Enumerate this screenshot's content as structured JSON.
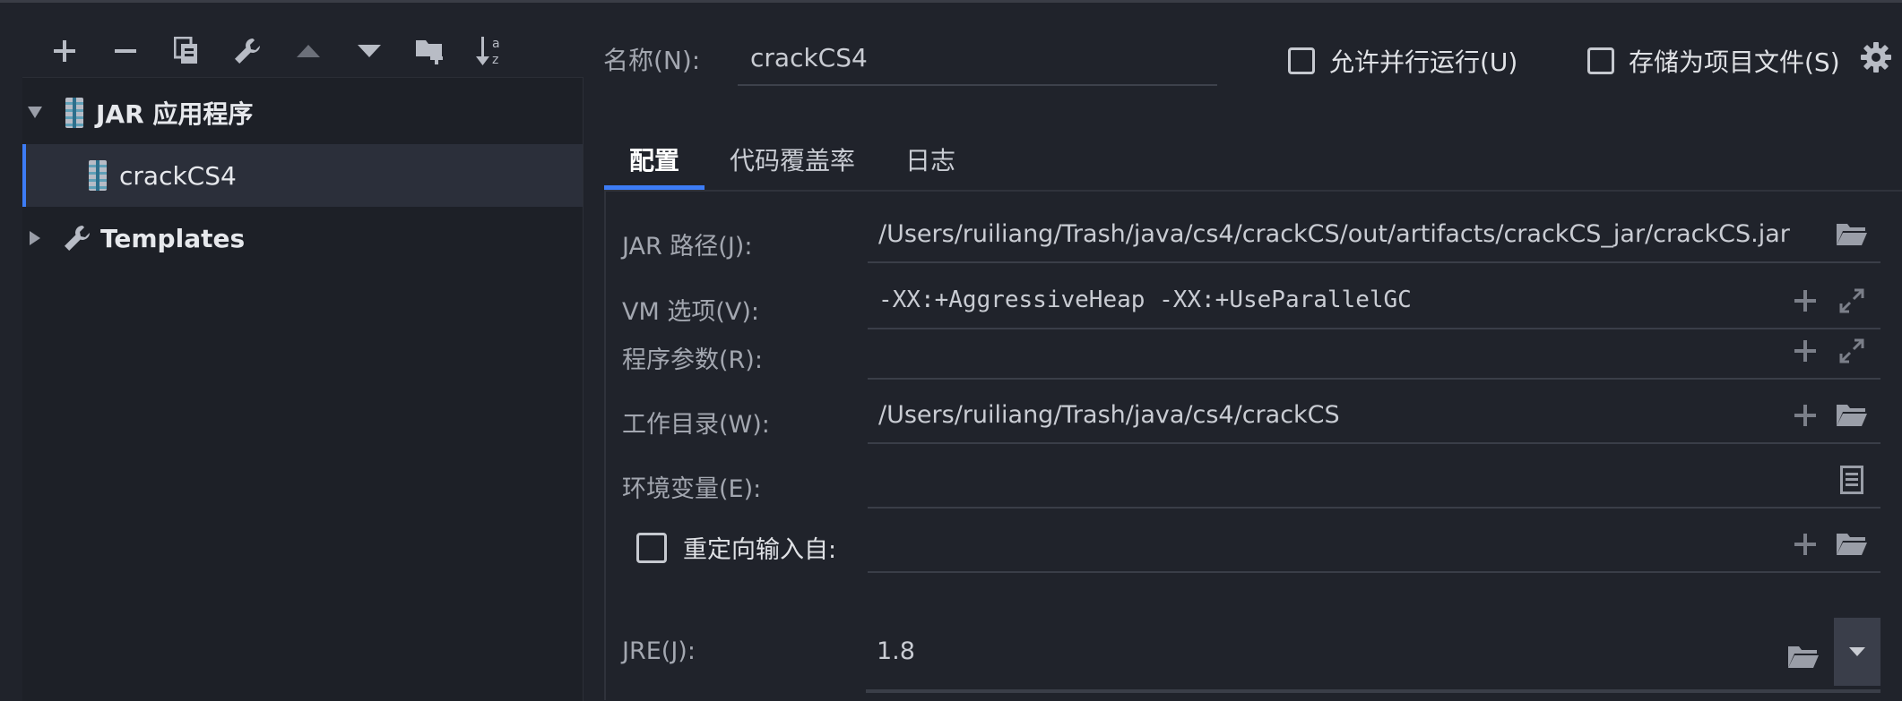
{
  "toolbar": {
    "buttons": [
      "add-icon",
      "remove-icon",
      "copy-icon",
      "wrench-icon",
      "move-up-icon",
      "move-down-icon",
      "new-folder-icon",
      "sort-az-icon"
    ]
  },
  "tree": {
    "items": [
      {
        "label": "JAR 应用程序",
        "expanded": true,
        "icon": "jar-icon"
      },
      {
        "label": "crackCS4",
        "selected": true,
        "icon": "jar-icon"
      },
      {
        "label": "Templates",
        "expanded": false,
        "icon": "wrench-icon"
      }
    ]
  },
  "header": {
    "name_label": "名称(N):",
    "name_value": "crackCS4",
    "allow_parallel": "允许并行运行(U)",
    "store_as_project": "存储为项目文件(S)"
  },
  "tabs": [
    "配置",
    "代码覆盖率",
    "日志"
  ],
  "form": {
    "jar_path_label": "JAR 路径(J):",
    "jar_path_value": "/Users/ruiliang/Trash/java/cs4/crackCS/out/artifacts/crackCS_jar/crackCS.jar",
    "vm_label": "VM 选项(V):",
    "vm_value": "-XX:+AggressiveHeap -XX:+UseParallelGC",
    "args_label": "程序参数(R):",
    "args_value": "",
    "workdir_label": "工作目录(W):",
    "workdir_value": "/Users/ruiliang/Trash/java/cs4/crackCS",
    "env_label": "环境变量(E):",
    "env_value": "",
    "redirect_label": "重定向输入自:",
    "redirect_value": "",
    "jre_label": "JRE(J):",
    "jre_value": "1.8"
  },
  "colors": {
    "background": "#20232b",
    "tree_background": "#1d2027",
    "selection": "#2b2f3a",
    "accent": "#3d7cf5",
    "text": "#c9ccd3"
  }
}
